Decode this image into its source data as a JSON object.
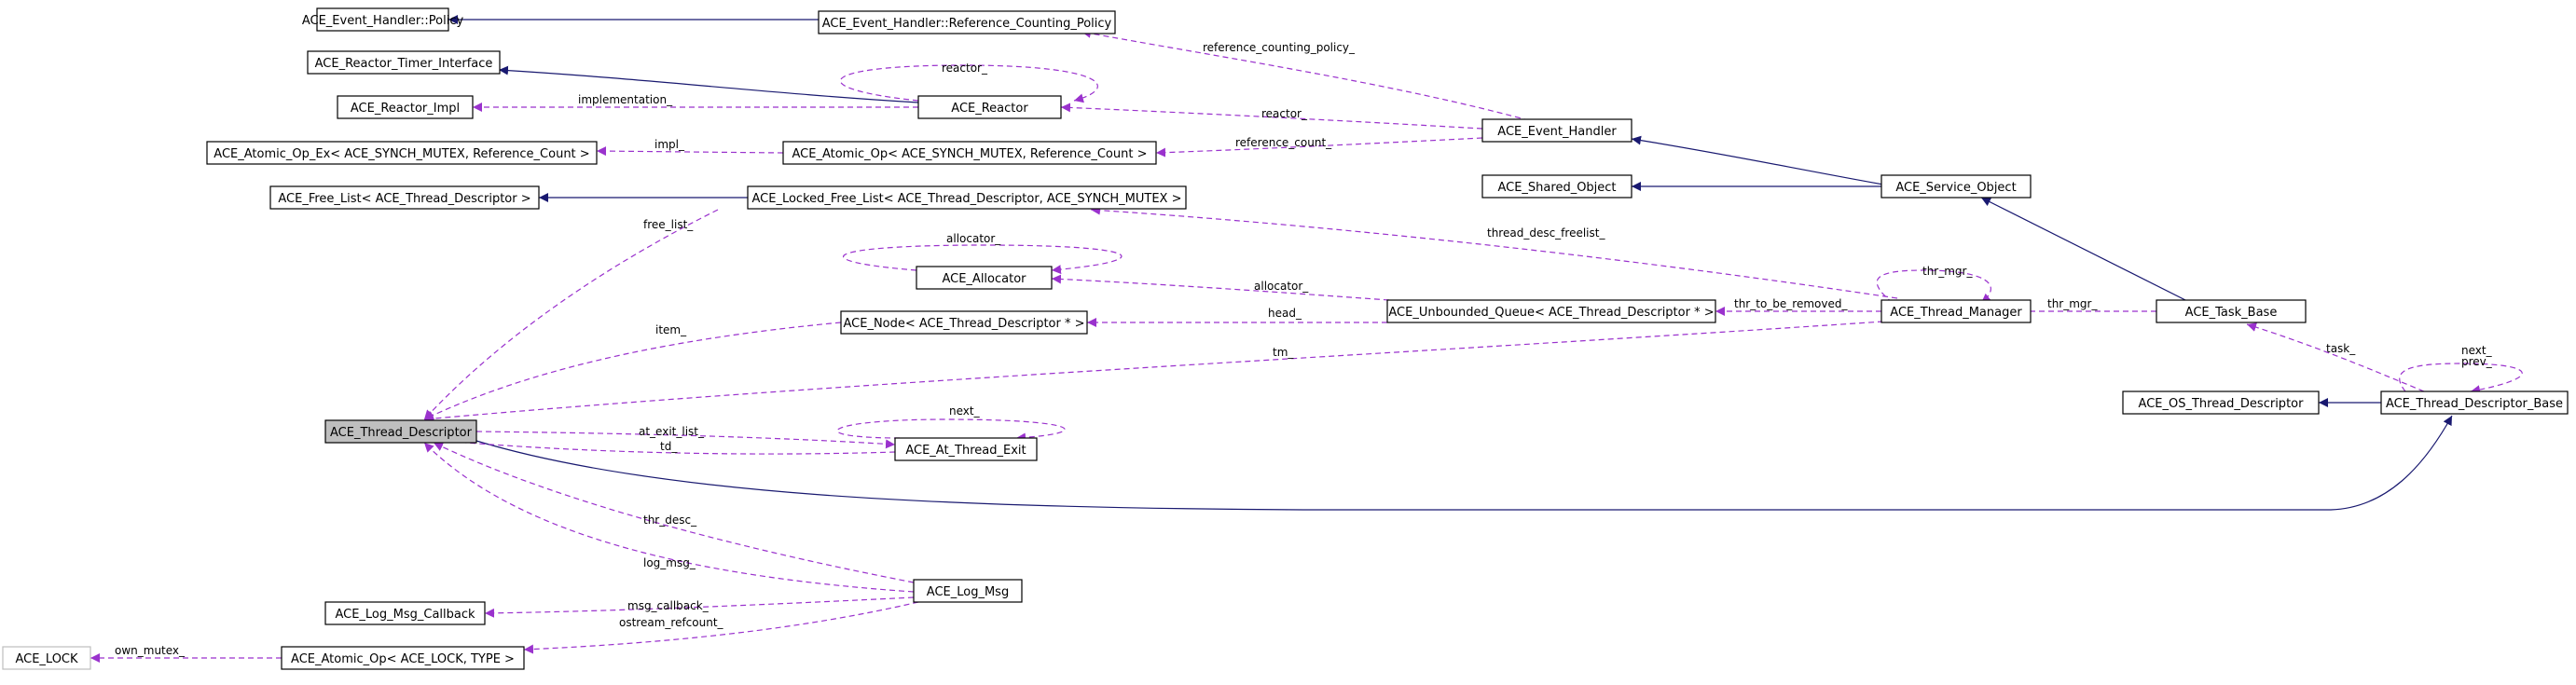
{
  "nodes": {
    "handler_policy": "ACE_Event_Handler::Policy",
    "ref_counting_policy": "ACE_Event_Handler::Reference_Counting_Policy",
    "reactor_timer_interface": "ACE_Reactor_Timer_Interface",
    "reactor_impl": "ACE_Reactor_Impl",
    "reactor": "ACE_Reactor",
    "event_handler": "ACE_Event_Handler",
    "atomic_op_ex": "ACE_Atomic_Op_Ex< ACE_SYNCH_MUTEX, Reference_Count >",
    "atomic_op_mutex": "ACE_Atomic_Op< ACE_SYNCH_MUTEX, Reference_Count >",
    "shared_object": "ACE_Shared_Object",
    "free_list": "ACE_Free_List< ACE_Thread_Descriptor >",
    "locked_free_list": "ACE_Locked_Free_List< ACE_Thread_Descriptor, ACE_SYNCH_MUTEX >",
    "service_object": "ACE_Service_Object",
    "allocator": "ACE_Allocator",
    "node_td": "ACE_Node< ACE_Thread_Descriptor * >",
    "unbounded_queue": "ACE_Unbounded_Queue< ACE_Thread_Descriptor * >",
    "thread_manager": "ACE_Thread_Manager",
    "task_base": "ACE_Task_Base",
    "thread_descriptor": "ACE_Thread_Descriptor",
    "at_thread_exit": "ACE_At_Thread_Exit",
    "os_thread_descriptor": "ACE_OS_Thread_Descriptor",
    "thread_descriptor_base": "ACE_Thread_Descriptor_Base",
    "log_msg": "ACE_Log_Msg",
    "log_msg_callback": "ACE_Log_Msg_Callback",
    "ace_lock": "ACE_LOCK",
    "atomic_op_lock": "ACE_Atomic_Op< ACE_LOCK, TYPE >"
  },
  "edge_labels": {
    "reference_counting_policy": "reference_counting_policy_",
    "reactor_self": "reactor_",
    "implementation": "implementation_",
    "reactor": "reactor_",
    "impl": "impl_",
    "reference_count": "reference_count_",
    "free_list": "free_list_",
    "thread_desc_freelist": "thread_desc_freelist_",
    "allocator_self": "allocator_",
    "allocator": "allocator_",
    "thr_mgr_self": "thr_mgr_",
    "item": "item_",
    "head": "head_",
    "thr_to_be_removed": "thr_to_be_removed_",
    "thr_mgr": "thr_mgr_",
    "tm": "tm_",
    "task": "task_",
    "next_prev": "next_\nprev_",
    "next": "next_",
    "at_exit_list": "at_exit_list_",
    "td": "td_",
    "thr_desc": "thr_desc_",
    "log_msg": "log_msg_",
    "msg_callback": "msg_callback_",
    "ostream_refcount": "ostream_refcount_",
    "own_mutex": "own_mutex_"
  },
  "colors": {
    "inheritance": "#191970",
    "usage": "#9a32cd",
    "highlight_fill": "#bfbfbf"
  }
}
